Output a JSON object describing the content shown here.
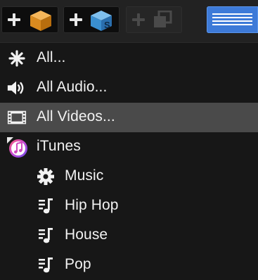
{
  "toolbar": {
    "buttons": [
      {
        "icon": "box-icon",
        "state": "enabled"
      },
      {
        "icon": "s-box-icon",
        "state": "enabled"
      },
      {
        "icon": "stacked-squares-icon",
        "state": "disabled"
      }
    ],
    "view_toggle": {
      "icon": "list-view-icon",
      "state": "selected"
    }
  },
  "menu": {
    "items": [
      {
        "label": "All...",
        "icon": "asterisk-icon"
      },
      {
        "label": "All Audio...",
        "icon": "speaker-icon"
      },
      {
        "label": "All Videos...",
        "icon": "film-strip-icon",
        "selected": true
      },
      {
        "label": "iTunes",
        "icon": "itunes-icon"
      },
      {
        "label": "Music",
        "icon": "gear-icon"
      },
      {
        "label": "Hip Hop",
        "icon": "playlist-icon"
      },
      {
        "label": "House",
        "icon": "playlist-icon"
      },
      {
        "label": "Pop",
        "icon": "playlist-icon"
      }
    ]
  },
  "colors": {
    "accent": "#3d7ad8",
    "selection": "#4a4a4a",
    "background": "#171717",
    "text": "#f2f2f2"
  }
}
